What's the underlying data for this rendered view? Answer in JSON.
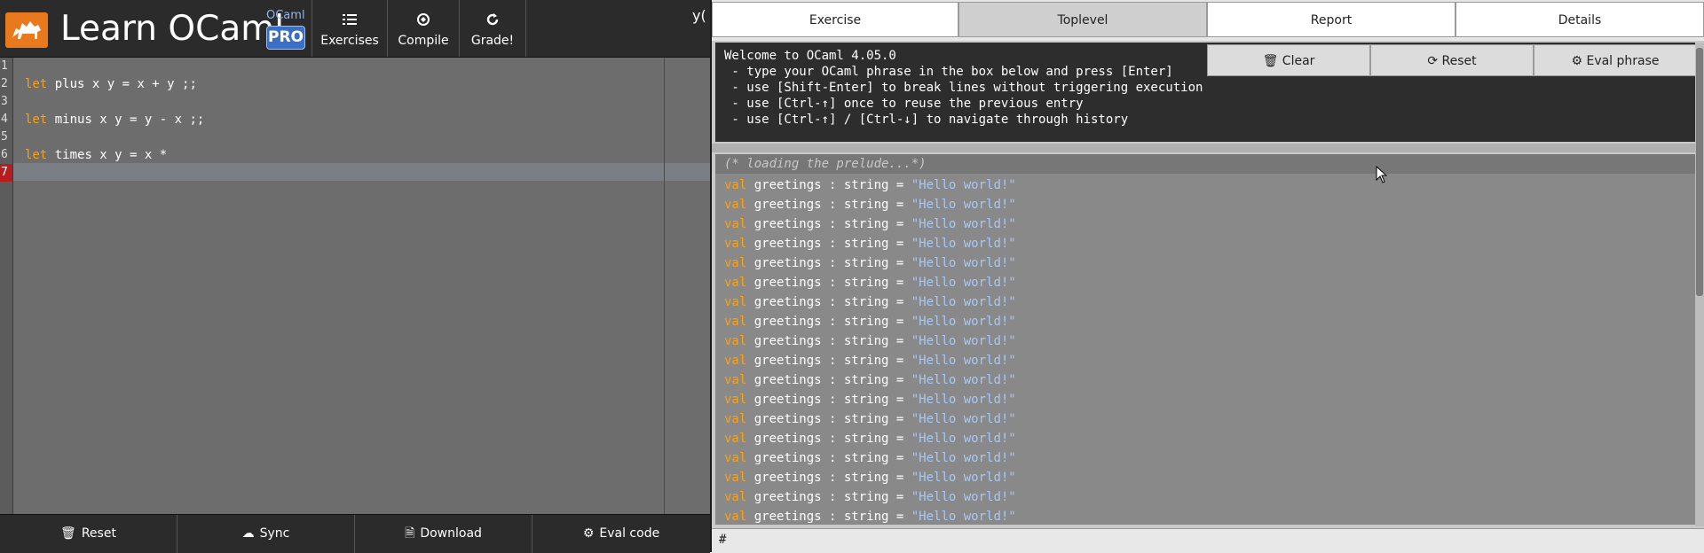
{
  "app": {
    "title": "Learn OCaml",
    "subtitle": "OCaml",
    "badge": "PRO",
    "clipped_text": "y("
  },
  "toolbar": {
    "exercises_label": "Exercises",
    "compile_label": "Compile",
    "grade_label": "Grade!"
  },
  "editor": {
    "line_numbers": [
      "1",
      "2",
      "3",
      "4",
      "5",
      "6",
      "7"
    ],
    "error_line": "7",
    "lines": [
      {
        "kw": "",
        "rest": ""
      },
      {
        "kw": "let",
        "rest": " plus x y = x + y ;;"
      },
      {
        "kw": "",
        "rest": ""
      },
      {
        "kw": "let",
        "rest": " minus x y = y - x ;;"
      },
      {
        "kw": "",
        "rest": ""
      },
      {
        "kw": "let",
        "rest": " times x y = x *"
      },
      {
        "kw": "",
        "rest": ""
      }
    ]
  },
  "editor_actions": {
    "reset_label": "Reset",
    "sync_label": "Sync",
    "download_label": "Download",
    "eval_label": "Eval code"
  },
  "tabs": {
    "exercise": "Exercise",
    "toplevel": "Toplevel",
    "report": "Report",
    "details": "Details",
    "active": "Toplevel"
  },
  "toplevel": {
    "welcome_lines": [
      "Welcome to OCaml 4.05.0",
      " - type your OCaml phrase in the box below and press [Enter]",
      " - use [Shift-Enter] to break lines without triggering execution",
      " - use [Ctrl-↑] once to reuse the previous entry",
      " - use [Ctrl-↑] / [Ctrl-↓] to navigate through history"
    ],
    "clear_label": "Clear",
    "reset_label": "Reset",
    "eval_label": "Eval phrase",
    "loading_text": "(* loading the prelude...*)",
    "output_kw": "val",
    "output_mid": " greetings : string = ",
    "output_str": "\"Hello world!\"",
    "output_count": 18,
    "prompt": "#",
    "input_value": ""
  },
  "colors": {
    "keyword": "#f6a21a",
    "string": "#a9c8f4",
    "error_gutter": "#b81c1c",
    "logo": "#e8791d",
    "badge": "#3a6fc4"
  },
  "icons": {
    "exercises": "list-icon",
    "compile": "compile-icon",
    "grade": "refresh-icon",
    "trash": "trash-icon",
    "sync": "sync-icon",
    "download": "download-icon",
    "gear": "gear-icon"
  }
}
